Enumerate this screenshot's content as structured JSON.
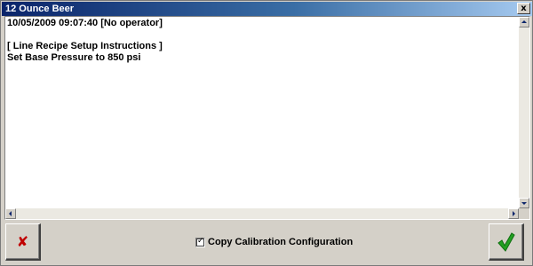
{
  "window": {
    "title": "12 Ounce Beer",
    "close_glyph": "x"
  },
  "log": {
    "lines": [
      "10/05/2009 09:07:40 [No operator]",
      "",
      "[ Line Recipe Setup Instructions ]",
      "Set Base Pressure to 850 psi"
    ]
  },
  "footer": {
    "checkbox_label": "Copy Calibration Configuration",
    "checkbox_checked": true,
    "check_glyph": "✓",
    "cancel_glyph": "✘",
    "cancel_color": "#c00000",
    "ok_color": "#22a022"
  }
}
